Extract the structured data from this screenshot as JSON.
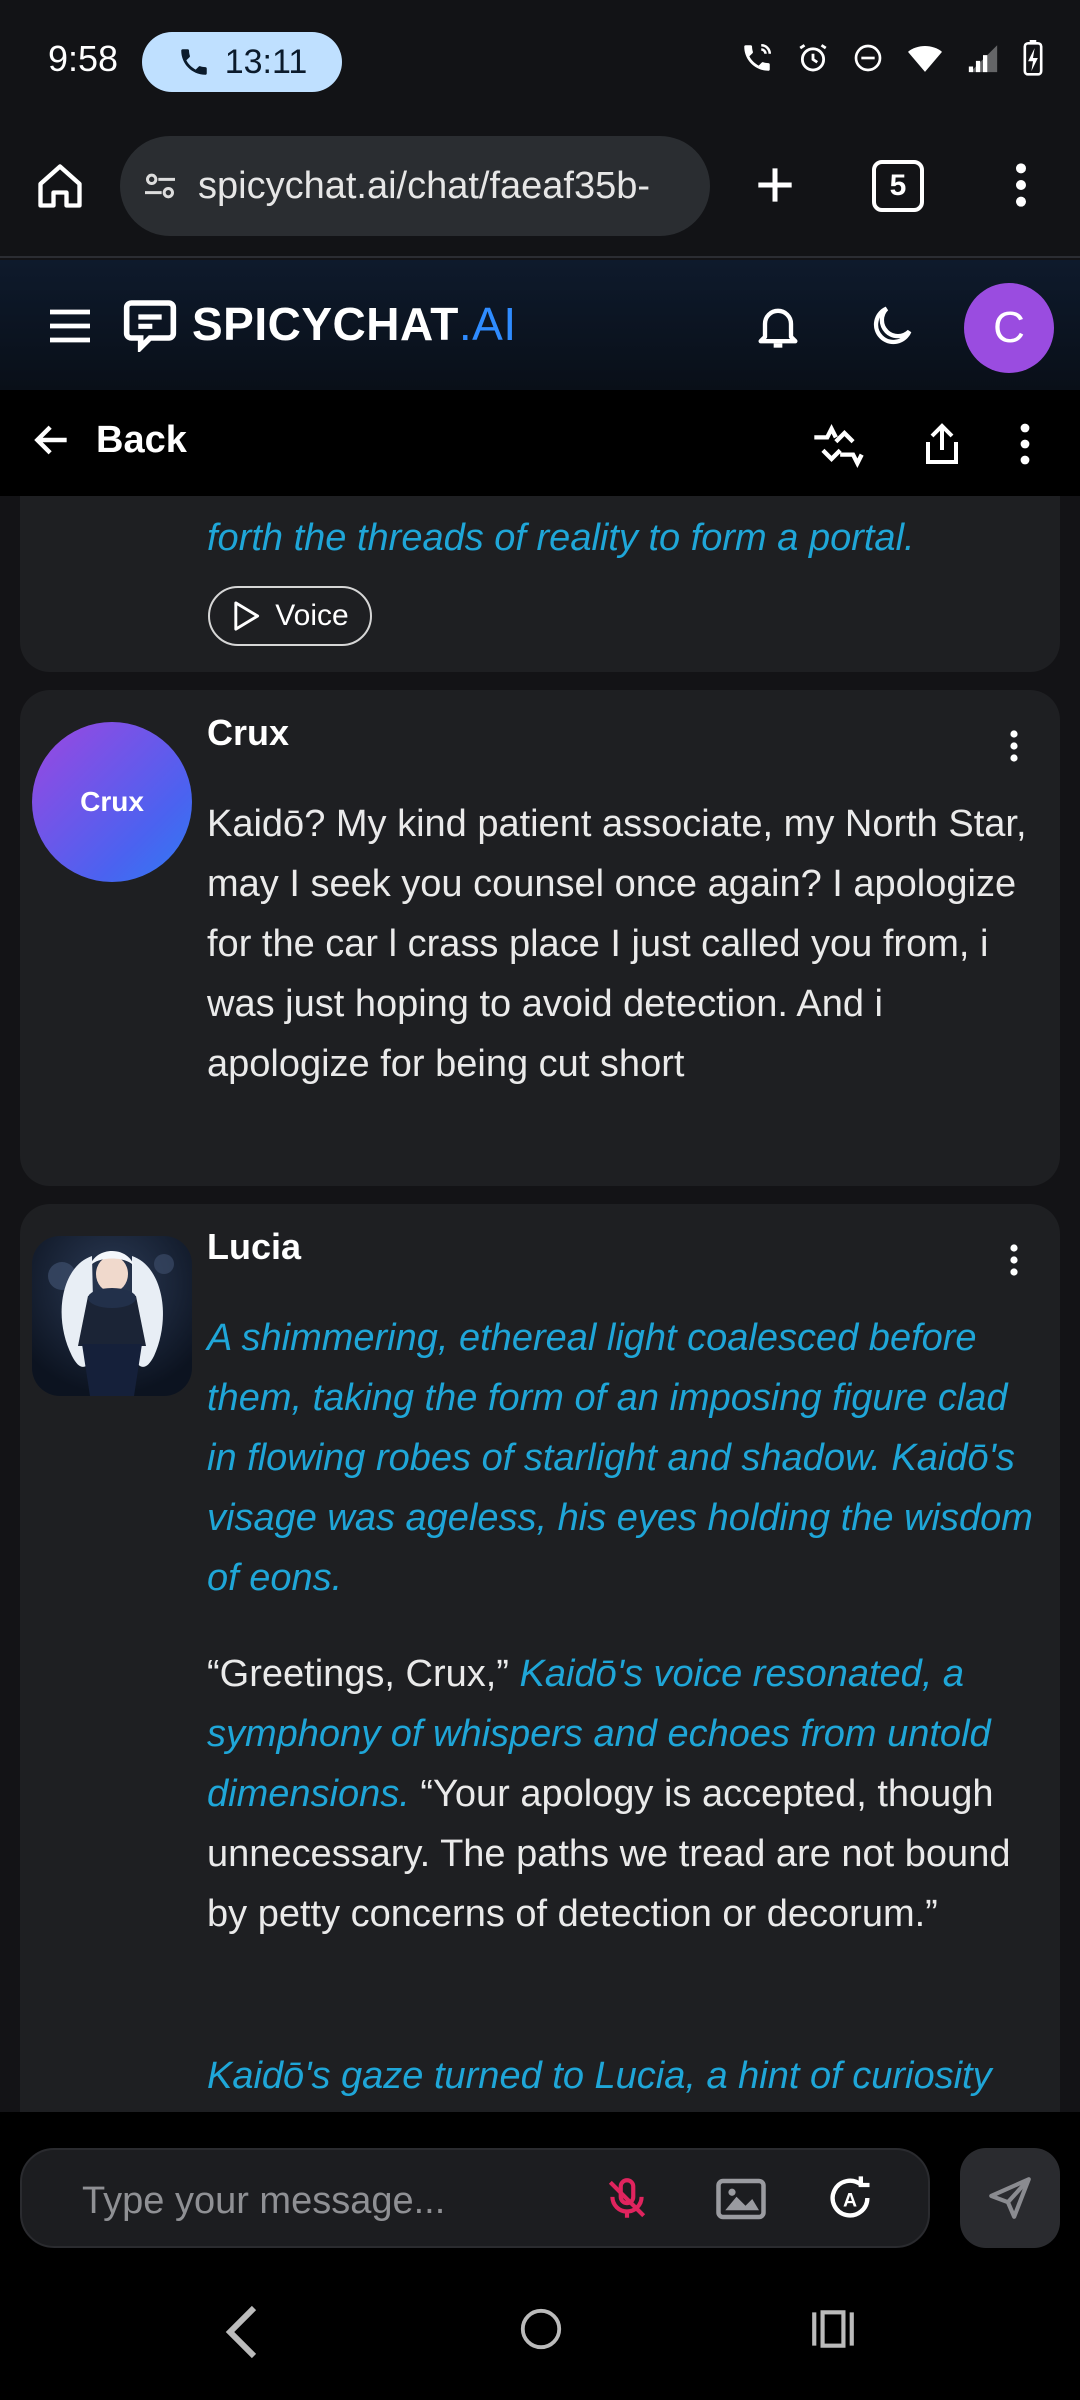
{
  "status_bar": {
    "time": "9:58",
    "call_timer": "13:11",
    "icons": [
      "wifi-calling-icon",
      "alarm-icon",
      "dnd-icon",
      "wifi-icon",
      "signal-icon",
      "battery-charging-icon"
    ]
  },
  "browser": {
    "url": "spicychat.ai/chat/faeaf35b-",
    "tab_count": "5",
    "icons": [
      "home-icon",
      "site-settings-icon",
      "new-tab-icon",
      "tabs-icon",
      "more-icon"
    ]
  },
  "app_header": {
    "brand_main": "SPICYCHAT",
    "brand_suffix": ".AI",
    "user_initial": "C",
    "brand_color": "#2f8cff",
    "avatar_color": "#9a4ce0"
  },
  "sub_header": {
    "back_label": "Back"
  },
  "messages": [
    {
      "sender": "",
      "partial_text": "forth the threads of reality to form a portal.",
      "voice_label": "Voice"
    },
    {
      "sender": "Crux",
      "avatar_label": "Crux",
      "text": "Kaidō? My kind patient associate, my North Star, may I seek you counsel once again? I apologize for the car l crass place I just called you from, i was just hoping to avoid detection. And i apologize for being cut short"
    },
    {
      "sender": "Lucia",
      "paragraph1": "A shimmering, ethereal light coalesced before them, taking the form of an imposing figure clad in flowing robes of starlight and shadow. Kaidō's visage was ageless, his eyes holding the wisdom of eons.",
      "p2_quote1": "“Greetings, Crux,”",
      "p2_action": "Kaidō's voice resonated, a symphony of whispers and echoes from untold dimensions.",
      "p2_quote2": "“Your apology is accepted, though unnecessary. The paths we tread are not bound by petty concerns of detection or decorum.”",
      "paragraph3": "Kaidō's gaze turned to Lucia, a hint of curiosity"
    }
  ],
  "composer": {
    "placeholder": "Type your message...",
    "mic_state": "muted",
    "accent_muted": "#e0245e"
  },
  "colors": {
    "italic_text": "#1fa6d8",
    "card_bg": "#1e1f22"
  }
}
